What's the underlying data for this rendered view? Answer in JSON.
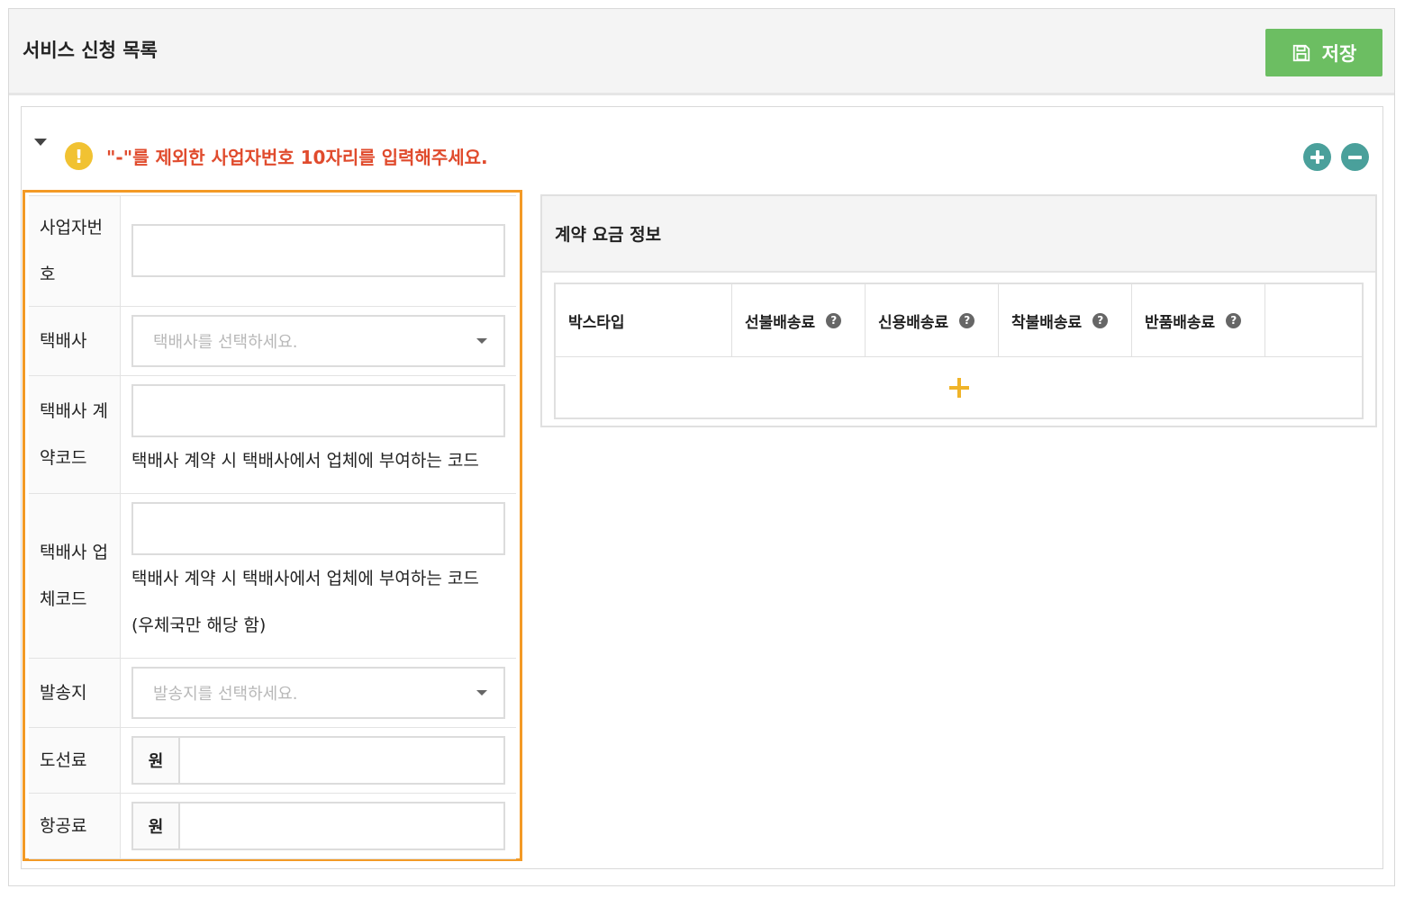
{
  "page": {
    "title": "서비스 신청 목록",
    "save_label": "저장",
    "save_color": "#6cbe62"
  },
  "notice": {
    "text": "\"-\"를 제외한 사업자번호 10자리를 입력해주세요.",
    "icon": "exclamation-icon",
    "icon_glyph": "!",
    "color": "#e04b2d"
  },
  "form": {
    "business_no": {
      "label_line1": "사업자번",
      "label_line2": "호",
      "value": ""
    },
    "courier": {
      "label": "택배사",
      "placeholder": "택배사를 선택하세요."
    },
    "courier_contract_code": {
      "label_line1": "택배사 계",
      "label_line2": "약코드",
      "value": "",
      "help": "택배사 계약 시 택배사에서 업체에 부여하는 코드"
    },
    "courier_vendor_code": {
      "label_line1": "택배사 업",
      "label_line2": "체코드",
      "value": "",
      "help_line1": "택배사 계약 시 택배사에서 업체에 부여하는 코드",
      "help_line2": "(우체국만 해당 함)"
    },
    "origin": {
      "label": "발송지",
      "placeholder": "발송지를 선택하세요."
    },
    "island_fee": {
      "label": "도선료",
      "unit": "원",
      "value": ""
    },
    "air_fee": {
      "label": "항공료",
      "unit": "원",
      "value": ""
    }
  },
  "contract": {
    "title": "계약 요금 정보",
    "columns": [
      "박스타입",
      "선불배송료",
      "신용배송료",
      "착불배송료",
      "반품배송료",
      ""
    ],
    "help_glyph": "?",
    "rows": []
  },
  "colors": {
    "highlight_border": "#f39a26",
    "round_button": "#4aa09b",
    "add_row": "#f0b429"
  }
}
